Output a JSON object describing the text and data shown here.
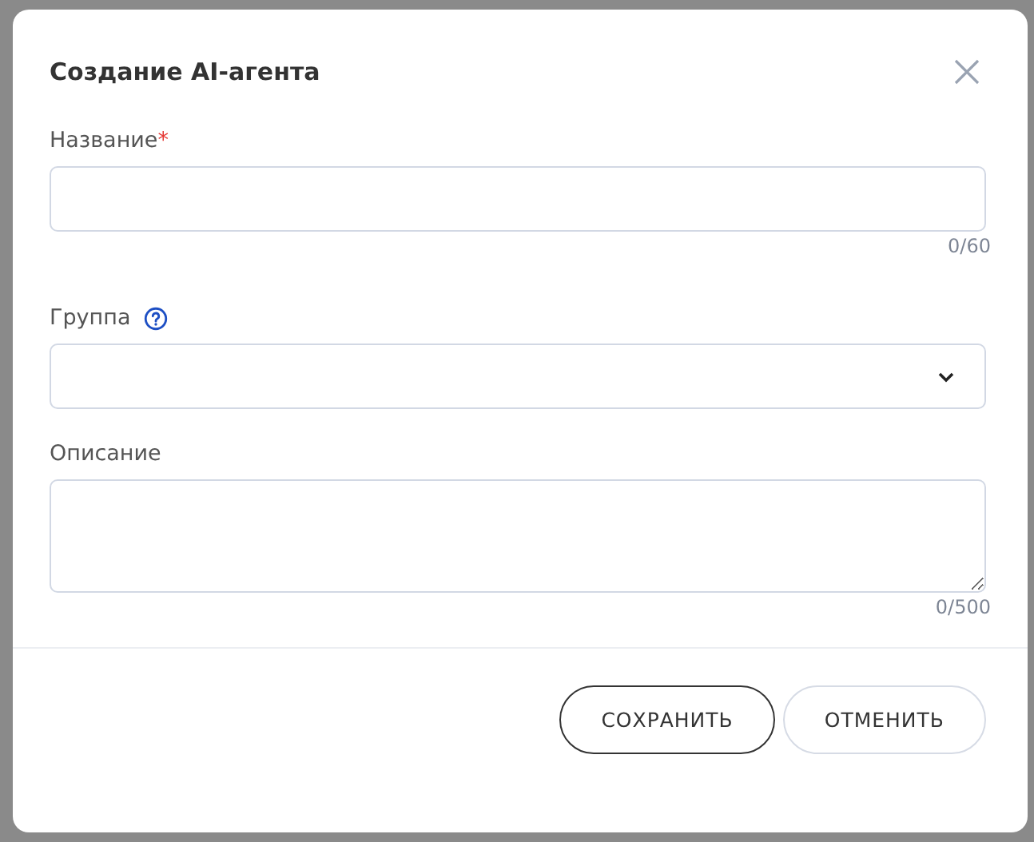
{
  "dialog": {
    "title": "Создание AI-агента",
    "fields": [
      {
        "kind": "text",
        "label": "Название",
        "required_mark": "*",
        "help": false,
        "counter": "0/60"
      },
      {
        "kind": "select",
        "label": "Группа",
        "help": true
      },
      {
        "kind": "textarea",
        "label": "Описание",
        "help": false,
        "counter": "0/500"
      }
    ],
    "buttons": [
      {
        "label": "СОХРАНИТЬ",
        "primary": true
      },
      {
        "label": "ОТМЕНИТЬ",
        "primary": false
      }
    ]
  }
}
